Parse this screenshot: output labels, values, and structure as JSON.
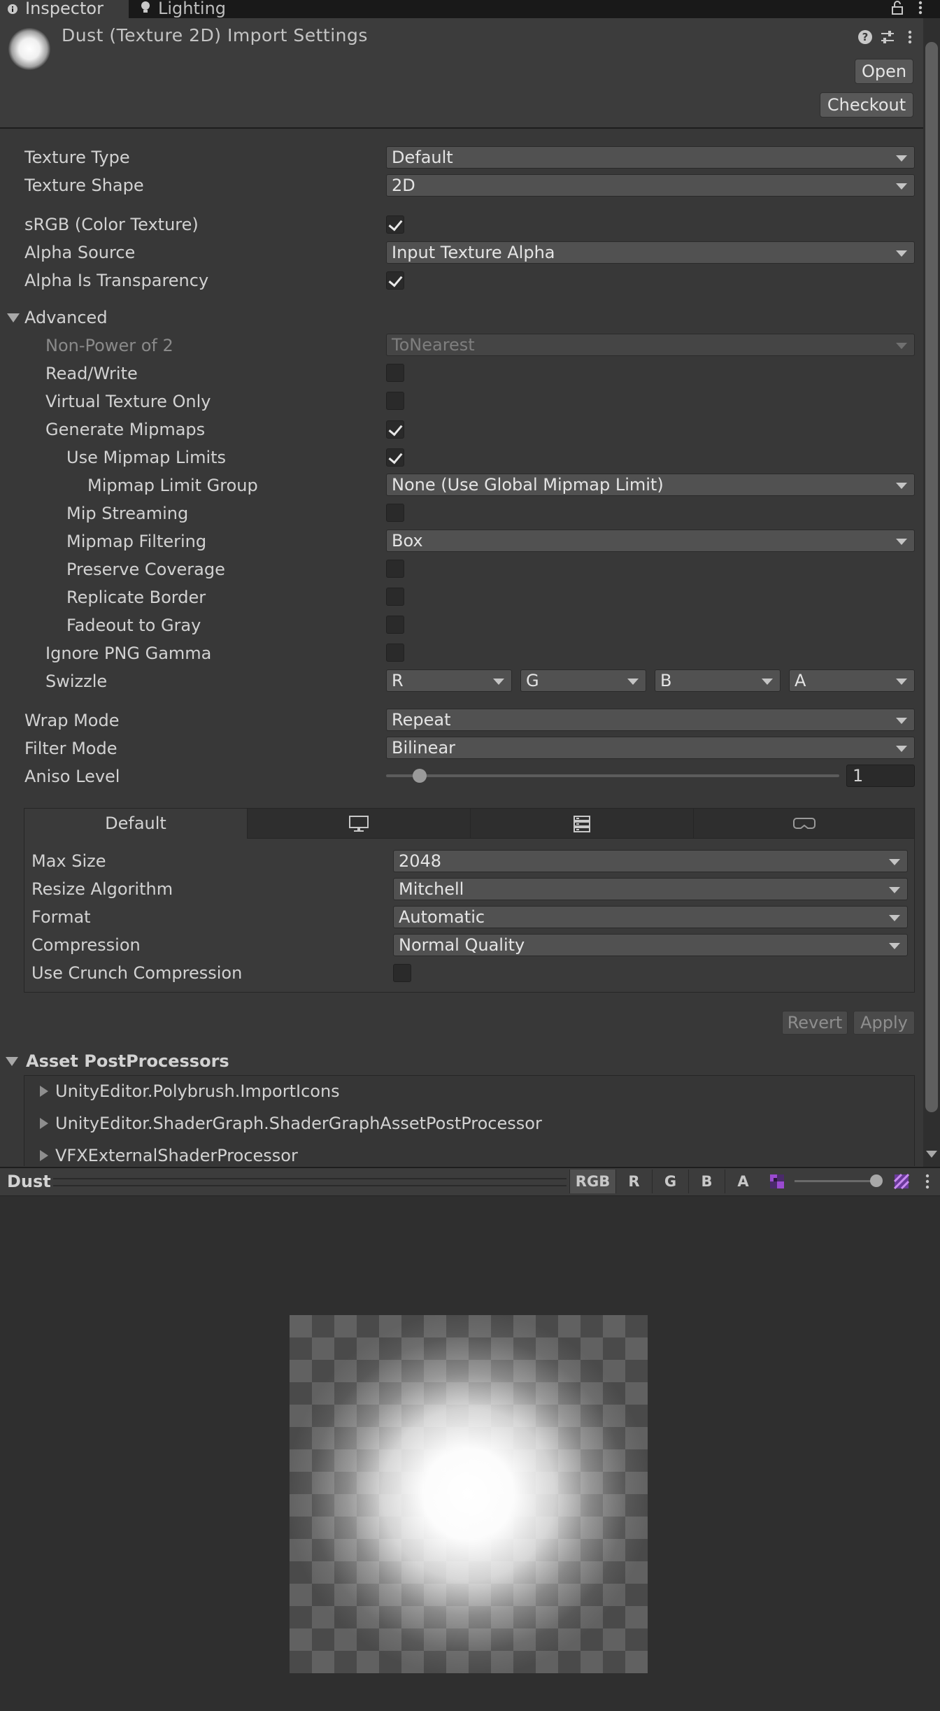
{
  "tabs": [
    {
      "label": "Inspector",
      "icon": "info-icon"
    },
    {
      "label": "Lighting",
      "icon": "lightbulb-icon"
    }
  ],
  "header": {
    "title": "Dust (Texture 2D) Import Settings",
    "open_label": "Open",
    "checkout_label": "Checkout"
  },
  "props": {
    "texture_type": {
      "label": "Texture Type",
      "value": "Default"
    },
    "texture_shape": {
      "label": "Texture Shape",
      "value": "2D"
    },
    "srgb": {
      "label": "sRGB (Color Texture)",
      "checked": true
    },
    "alpha_source": {
      "label": "Alpha Source",
      "value": "Input Texture Alpha"
    },
    "alpha_is_transparency": {
      "label": "Alpha Is Transparency",
      "checked": true
    },
    "advanced": {
      "label": "Advanced"
    },
    "non_power_of_2": {
      "label": "Non-Power of 2",
      "value": "ToNearest"
    },
    "read_write": {
      "label": "Read/Write",
      "checked": false
    },
    "virtual_texture_only": {
      "label": "Virtual Texture Only",
      "checked": false
    },
    "generate_mipmaps": {
      "label": "Generate Mipmaps",
      "checked": true
    },
    "use_mipmap_limits": {
      "label": "Use Mipmap Limits",
      "checked": true
    },
    "mipmap_limit_group": {
      "label": "Mipmap Limit Group",
      "value": "None (Use Global Mipmap Limit)"
    },
    "mip_streaming": {
      "label": "Mip Streaming",
      "checked": false
    },
    "mipmap_filtering": {
      "label": "Mipmap Filtering",
      "value": "Box"
    },
    "preserve_coverage": {
      "label": "Preserve Coverage",
      "checked": false
    },
    "replicate_border": {
      "label": "Replicate Border",
      "checked": false
    },
    "fadeout_to_gray": {
      "label": "Fadeout to Gray",
      "checked": false
    },
    "ignore_png_gamma": {
      "label": "Ignore PNG Gamma",
      "checked": false
    },
    "swizzle": {
      "label": "Swizzle",
      "values": [
        "R",
        "G",
        "B",
        "A"
      ]
    },
    "wrap_mode": {
      "label": "Wrap Mode",
      "value": "Repeat"
    },
    "filter_mode": {
      "label": "Filter Mode",
      "value": "Bilinear"
    },
    "aniso_level": {
      "label": "Aniso Level",
      "value": "1"
    }
  },
  "platform": {
    "tabs": [
      {
        "label": "Default"
      },
      {
        "icon": "monitor-icon"
      },
      {
        "icon": "server-icon"
      },
      {
        "icon": "vr-headset-icon"
      }
    ],
    "max_size": {
      "label": "Max Size",
      "value": "2048"
    },
    "resize_algorithm": {
      "label": "Resize Algorithm",
      "value": "Mitchell"
    },
    "format": {
      "label": "Format",
      "value": "Automatic"
    },
    "compression": {
      "label": "Compression",
      "value": "Normal Quality"
    },
    "use_crunch": {
      "label": "Use Crunch Compression",
      "checked": false
    }
  },
  "actions": {
    "revert": "Revert",
    "apply": "Apply"
  },
  "postprocessors": {
    "title": "Asset PostProcessors",
    "items": [
      "UnityEditor.Polybrush.ImportIcons",
      "UnityEditor.ShaderGraph.ShaderGraphAssetPostProcessor",
      "VFXExternalShaderProcessor"
    ]
  },
  "preview": {
    "title": "Dust",
    "channels": [
      "RGB",
      "R",
      "G",
      "B",
      "A"
    ],
    "active_channel": "RGB"
  },
  "colors": {
    "background": "#383838",
    "field": "#515151",
    "text": "#d2d2d2"
  }
}
